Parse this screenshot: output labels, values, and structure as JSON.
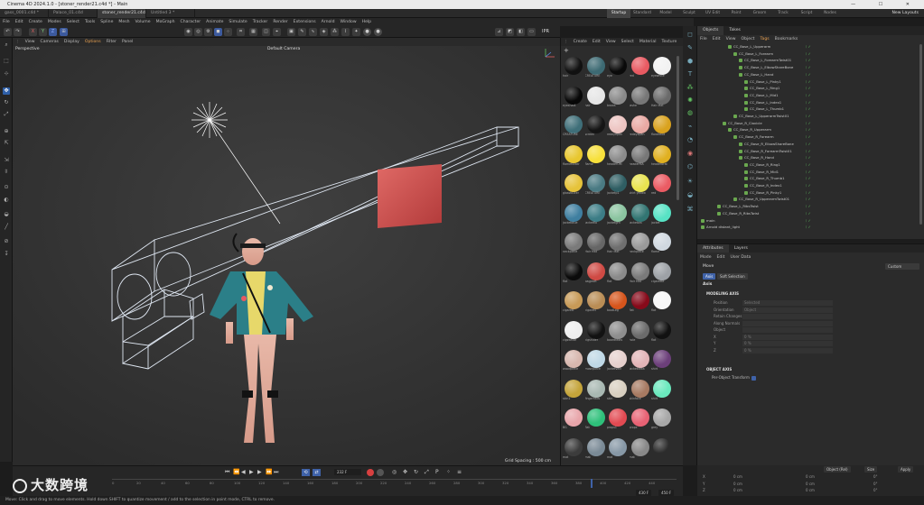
{
  "window": {
    "title": "Cinema 4D 2024.1.0 - [stoner_render21.c4d *] - Main",
    "controls": "— ☐ ✕"
  },
  "tabs": [
    "gass_0001.c4d *",
    "Palace_01.c4d",
    "stoner_render21.c4d *",
    "Untitled 3 *"
  ],
  "layouts": [
    "Startup",
    "Standard",
    "Model",
    "Sculpt",
    "UV Edit",
    "Paint",
    "Groom",
    "Track",
    "Script",
    "Nodes"
  ],
  "new_layouts": "New Layouts",
  "menu": [
    "File",
    "Edit",
    "Create",
    "Modes",
    "Select",
    "Tools",
    "Spline",
    "Mesh",
    "Volume",
    "MoGraph",
    "Character",
    "Animate",
    "Simulate",
    "Tracker",
    "Render",
    "Extensions",
    "Arnold",
    "Window",
    "Help"
  ],
  "viewport": {
    "menu": [
      "View",
      "Cameras",
      "Display",
      "Options",
      "Filter",
      "Panel"
    ],
    "label": "Perspective",
    "camera": "Default Camera",
    "grid_spacing": "Grid Spacing : 500 cm",
    "ipr": "IPR"
  },
  "materials": {
    "menu": [
      "Create",
      "Edit",
      "View",
      "Select",
      "Material",
      "Texture"
    ],
    "items": [
      {
        "name": "hair",
        "color": "#111111"
      },
      {
        "name": "CREATURE",
        "color": "#3d6a73"
      },
      {
        "name": "eye",
        "color": "#0a0a0a"
      },
      {
        "name": "red",
        "color": "#e85a62"
      },
      {
        "name": "eyewhite",
        "color": "#f2f2f2"
      },
      {
        "name": "eyeshadl",
        "color": "#070707"
      },
      {
        "name": "hair",
        "color": "#e6e6e6"
      },
      {
        "name": "brows",
        "color": "#8a8a8a"
      },
      {
        "name": "lashe",
        "color": "#777777"
      },
      {
        "name": "Hair Mat",
        "color": "#6a6a6a"
      },
      {
        "name": "CREATURE",
        "color": "#3f6f79"
      },
      {
        "name": "screen",
        "color": "#151515"
      },
      {
        "name": "redeyepan",
        "color": "#edc5c2"
      },
      {
        "name": "redeyepan",
        "color": "#e9a9a3"
      },
      {
        "name": "floraltexd",
        "color": "#d9a21e"
      },
      {
        "name": "flameflicker",
        "color": "#e8c72f"
      },
      {
        "name": "flame",
        "color": "#f7e03b"
      },
      {
        "name": "headerOM",
        "color": "#8c8c8c"
      },
      {
        "name": "headerMA",
        "color": "#777777"
      },
      {
        "name": "headerbrat",
        "color": "#e0b020"
      },
      {
        "name": "glassto1ter",
        "color": "#e6c33a"
      },
      {
        "name": "CREATURE",
        "color": "#4a7a83"
      },
      {
        "name": "jacketp1",
        "color": "#2f5e63"
      },
      {
        "name": "shirt yellow",
        "color": "#e8e350"
      },
      {
        "name": "red",
        "color": "#ea5b63"
      },
      {
        "name": "jacketblue",
        "color": "#3f7fa0"
      },
      {
        "name": "jacketfla",
        "color": "#3c7d86"
      },
      {
        "name": "jacketgrn",
        "color": "#8bc4a0"
      },
      {
        "name": "jacketwa",
        "color": "#327572"
      },
      {
        "name": "jacket",
        "color": "#57e2c4"
      },
      {
        "name": "neckpiece",
        "color": "#7a7a7a"
      },
      {
        "name": "Hair Mat",
        "color": "#666666"
      },
      {
        "name": "Hair Mat",
        "color": "#6f6f6f"
      },
      {
        "name": "neckpiece",
        "color": "#9a9a9a"
      },
      {
        "name": "flame",
        "color": "#d0d8e0"
      },
      {
        "name": "flat",
        "color": "#0b0b0b"
      },
      {
        "name": "bagjeoft",
        "color": "#cf4a44"
      },
      {
        "name": "flat",
        "color": "#8a8a8a"
      },
      {
        "name": "Hair Mat",
        "color": "#7a7a7a"
      },
      {
        "name": "cigarette",
        "color": "#9da1a6"
      },
      {
        "name": "cigarett",
        "color": "#c79a57"
      },
      {
        "name": "cigarett",
        "color": "#b98d55"
      },
      {
        "name": "bootLeg",
        "color": "#d6551c"
      },
      {
        "name": "flat",
        "color": "#870a1a"
      },
      {
        "name": "flat",
        "color": "#f6f6f6"
      },
      {
        "name": "cigswhite",
        "color": "#efefef"
      },
      {
        "name": "cigshlder",
        "color": "#121212"
      },
      {
        "name": "boardtexts",
        "color": "#8e8e8e"
      },
      {
        "name": "hole",
        "color": "#6b6b6b"
      },
      {
        "name": "flat",
        "color": "#111111"
      },
      {
        "name": "woodplece",
        "color": "#d7b7ae"
      },
      {
        "name": "mosnpiece",
        "color": "#bfd8e6"
      },
      {
        "name": "jacketvelk",
        "color": "#e6d0cd"
      },
      {
        "name": "jacketveka",
        "color": "#e2b4b7"
      },
      {
        "name": "shirt",
        "color": "#6c3f7a"
      },
      {
        "name": "skin1",
        "color": "#c4a43a"
      },
      {
        "name": "fingernails",
        "color": "#a8b8b2"
      },
      {
        "name": "skin",
        "color": "#d8cfc0"
      },
      {
        "name": "skinface",
        "color": "#a77a62"
      },
      {
        "name": "shirt",
        "color": "#6ae8bd"
      },
      {
        "name": "BG",
        "color": "#e8a5aa"
      },
      {
        "name": "flat",
        "color": "#2ec07a"
      },
      {
        "name": "props1",
        "color": "#e24a52"
      },
      {
        "name": "props",
        "color": "#e86274"
      },
      {
        "name": "grey",
        "color": "#a7a7a7"
      },
      {
        "name": "mat",
        "color": "#3c3c3c"
      },
      {
        "name": "mat",
        "color": "#7a8a96"
      },
      {
        "name": "mat",
        "color": "#8798a6"
      },
      {
        "name": "mat",
        "color": "#888888"
      },
      {
        "name": "",
        "color": "#2c2c2c"
      }
    ]
  },
  "objects": {
    "tabs": [
      "Objects",
      "Takes"
    ],
    "menu": [
      "File",
      "Edit",
      "View",
      "Object",
      "Tags",
      "Bookmarks"
    ],
    "rows": [
      {
        "name": "CC_Base_L_Upperarm",
        "indent": 5
      },
      {
        "name": "CC_Base_L_Forearm",
        "indent": 6
      },
      {
        "name": "CC_Base_L_ForearmTwist01",
        "indent": 7
      },
      {
        "name": "CC_Base_L_ElbowShareBone",
        "indent": 7
      },
      {
        "name": "CC_Base_L_Hand",
        "indent": 7
      },
      {
        "name": "CC_Base_L_Pinky1",
        "indent": 8
      },
      {
        "name": "CC_Base_L_Ring1",
        "indent": 8
      },
      {
        "name": "CC_Base_L_Mid1",
        "indent": 8
      },
      {
        "name": "CC_Base_L_Index1",
        "indent": 8
      },
      {
        "name": "CC_Base_L_Thumb1",
        "indent": 8
      },
      {
        "name": "CC_Base_L_UpperarmTwist01",
        "indent": 6
      },
      {
        "name": "CC_Base_R_Clavicle",
        "indent": 4
      },
      {
        "name": "CC_Base_R_Upperarm",
        "indent": 5
      },
      {
        "name": "CC_Base_R_Forearm",
        "indent": 6
      },
      {
        "name": "CC_Base_R_ElbowShareBone",
        "indent": 7
      },
      {
        "name": "CC_Base_R_ForearmTwist01",
        "indent": 7
      },
      {
        "name": "CC_Base_R_Hand",
        "indent": 7
      },
      {
        "name": "CC_Base_R_Ring1",
        "indent": 8
      },
      {
        "name": "CC_Base_R_Mid1",
        "indent": 8
      },
      {
        "name": "CC_Base_R_Thumb1",
        "indent": 8
      },
      {
        "name": "CC_Base_R_Index1",
        "indent": 8
      },
      {
        "name": "CC_Base_R_Pinky1",
        "indent": 8
      },
      {
        "name": "CC_Base_R_UpperarmTwist01",
        "indent": 6
      },
      {
        "name": "CC_Base_L_RibsTwist",
        "indent": 3
      },
      {
        "name": "CC_Base_R_RibsTwist",
        "indent": 3
      },
      {
        "name": "main",
        "indent": 0
      },
      {
        "name": "Arnold distant_light",
        "indent": 0
      }
    ]
  },
  "attributes": {
    "tabs": [
      "Attributes",
      "Layers"
    ],
    "menu": [
      "Mode",
      "Edit",
      "User Data"
    ],
    "mode": "Move",
    "custom": "Custom",
    "subtabs": [
      "Axis",
      "Soft Selection"
    ],
    "section": "Axis",
    "modeling_axis": "MODELING AXIS",
    "fields": [
      {
        "label": "Position",
        "value": "Selected"
      },
      {
        "label": "Orientation",
        "value": "Object"
      },
      {
        "label": "Retain Changes",
        "value": ""
      },
      {
        "label": "Along Normals",
        "value": ""
      },
      {
        "label": "Object",
        "value": ""
      },
      {
        "label": "X",
        "value": "0 %"
      },
      {
        "label": "Y",
        "value": "0 %"
      },
      {
        "label": "Z",
        "value": "0 %"
      }
    ],
    "object_axis": "OBJECT AXIS",
    "per_object": "Per-Object Transform"
  },
  "timeline": {
    "frame": "232 F",
    "ticks": [
      "0",
      "20",
      "40",
      "60",
      "80",
      "100",
      "120",
      "140",
      "160",
      "180",
      "200",
      "220",
      "240",
      "260",
      "280",
      "300",
      "320",
      "340",
      "360",
      "380",
      "400",
      "420",
      "440"
    ],
    "start": "0 F",
    "end": "430 F",
    "end2": "450 F"
  },
  "coords": {
    "headers": [
      "Move",
      "Scale",
      "Rotate"
    ],
    "apply": "Apply",
    "mode": "Object (Rel)",
    "axis": "Size",
    "rows": [
      {
        "axis": "X",
        "pos": "0 cm",
        "size": "0 cm",
        "rot": "0°"
      },
      {
        "axis": "Y",
        "pos": "0 cm",
        "size": "0 cm",
        "rot": "0°"
      },
      {
        "axis": "Z",
        "pos": "0 cm",
        "size": "0 cm",
        "rot": "0°"
      }
    ]
  },
  "statusbar": "Move: Click and drag to move elements. Hold down SHIFT to quantize movement / add to the selection in point mode, CTRL to remove.",
  "watermark": "大数跨境"
}
